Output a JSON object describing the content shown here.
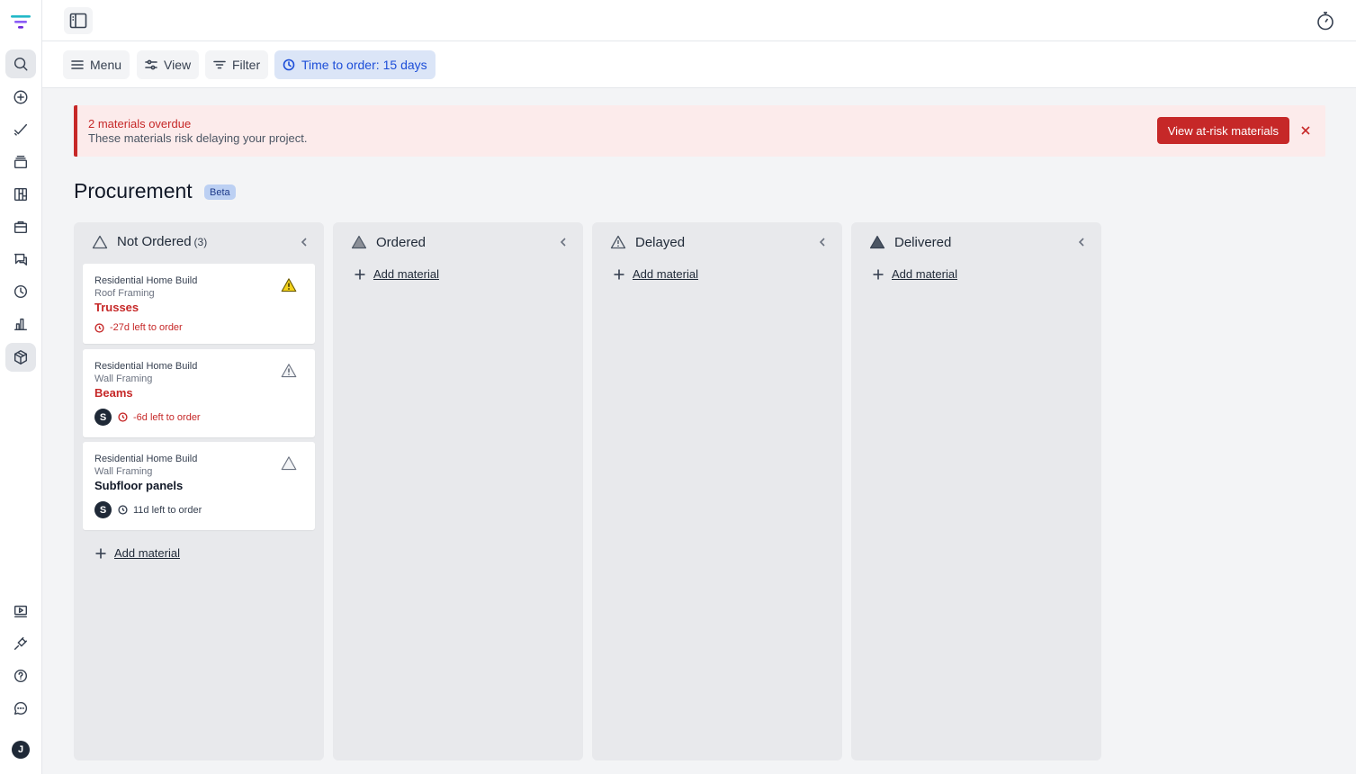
{
  "rail": {
    "avatar_initial": "J",
    "items": [
      {
        "icon": "search-icon"
      },
      {
        "icon": "plus-circle-icon"
      },
      {
        "icon": "check-icon"
      },
      {
        "icon": "stack-icon"
      },
      {
        "icon": "board-icon"
      },
      {
        "icon": "briefcase-icon"
      },
      {
        "icon": "chat-icon"
      },
      {
        "icon": "clock-icon"
      },
      {
        "icon": "bar-chart-icon"
      },
      {
        "icon": "box-icon"
      },
      {
        "icon": "video-icon"
      },
      {
        "icon": "plug-icon"
      },
      {
        "icon": "help-icon"
      },
      {
        "icon": "message-icon"
      }
    ]
  },
  "toolbar": {
    "menu_label": "Menu",
    "view_label": "View",
    "filter_label": "Filter",
    "time_label": "Time to order:",
    "time_value": "15 days"
  },
  "alert": {
    "title": "2 materials overdue",
    "subtitle": "These materials risk delaying your project.",
    "button": "View at-risk materials"
  },
  "page": {
    "title": "Procurement",
    "badge": "Beta"
  },
  "columns": [
    {
      "title": "Not Ordered",
      "count": "(3)",
      "add_label": "Add material",
      "cards": [
        {
          "project": "Residential Home Build",
          "phase": "Roof Framing",
          "name": "Trusses",
          "status": "-27d left to order"
        },
        {
          "project": "Residential Home Build",
          "phase": "Wall Framing",
          "name": "Beams",
          "assignee": "S",
          "status": "-6d left to order"
        },
        {
          "project": "Residential Home Build",
          "phase": "Wall Framing",
          "name": "Subfloor panels",
          "assignee": "S",
          "status": "11d left to order"
        }
      ]
    },
    {
      "title": "Ordered",
      "add_label": "Add material"
    },
    {
      "title": "Delayed",
      "add_label": "Add material"
    },
    {
      "title": "Delivered",
      "add_label": "Add material"
    }
  ],
  "colors": {
    "danger": "#c62828",
    "accent": "#1d4ed8",
    "warning": "#e5c100"
  }
}
